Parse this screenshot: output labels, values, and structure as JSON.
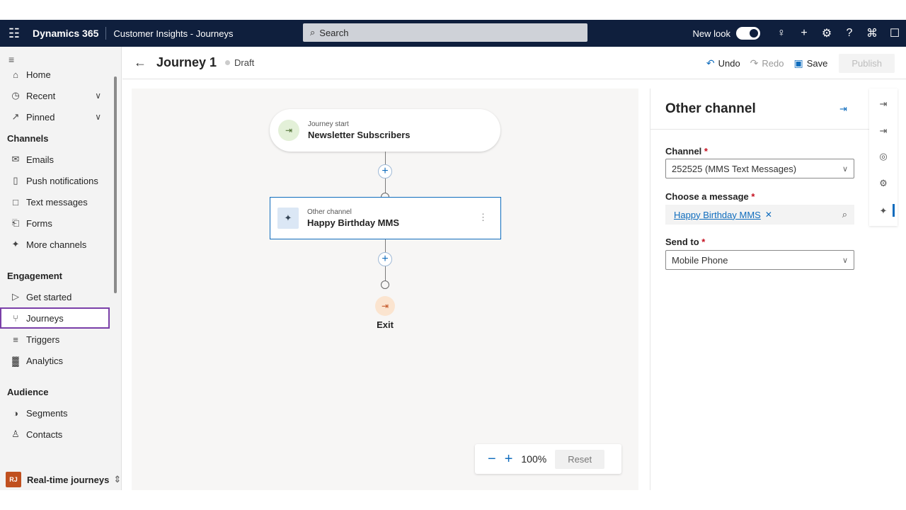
{
  "topbar": {
    "brand": "Dynamics 365",
    "app_name": "Customer Insights - Journeys",
    "search_placeholder": "Search",
    "new_look_label": "New look"
  },
  "sidebar": {
    "items_top": [
      {
        "label": "Home",
        "icon": "home-icon"
      },
      {
        "label": "Recent",
        "icon": "clock-icon"
      },
      {
        "label": "Pinned",
        "icon": "pin-icon"
      }
    ],
    "sections": {
      "channels": "Channels",
      "engagement": "Engagement",
      "audience": "Audience"
    },
    "channels": [
      "Emails",
      "Push notifications",
      "Text messages",
      "Forms",
      "More channels"
    ],
    "engagement": [
      "Get started",
      "Journeys",
      "Triggers",
      "Analytics"
    ],
    "audience": [
      "Segments",
      "Contacts"
    ],
    "area_initials": "RJ",
    "area_label": "Real-time journeys"
  },
  "command_bar": {
    "title": "Journey 1",
    "status": "Draft",
    "undo": "Undo",
    "redo": "Redo",
    "save": "Save",
    "publish": "Publish"
  },
  "canvas": {
    "start_node": {
      "sub": "Journey start",
      "main": "Newsletter Subscribers"
    },
    "channel_node": {
      "sub": "Other channel",
      "main": "Happy Birthday MMS"
    },
    "exit_label": "Exit",
    "zoom": "100%",
    "reset": "Reset"
  },
  "panel": {
    "title": "Other channel",
    "channel_label": "Channel",
    "channel_value": "252525 (MMS Text Messages)",
    "message_label": "Choose a message",
    "message_value": "Happy Birthday MMS",
    "send_to_label": "Send to",
    "send_to_value": "Mobile Phone",
    "required_marker": "*"
  },
  "colors": {
    "topbar_bg": "#0f1f3d",
    "accent": "#0f6cbd",
    "active_nav_outline": "#7a3fa8",
    "exit_accent": "#c0501f"
  }
}
